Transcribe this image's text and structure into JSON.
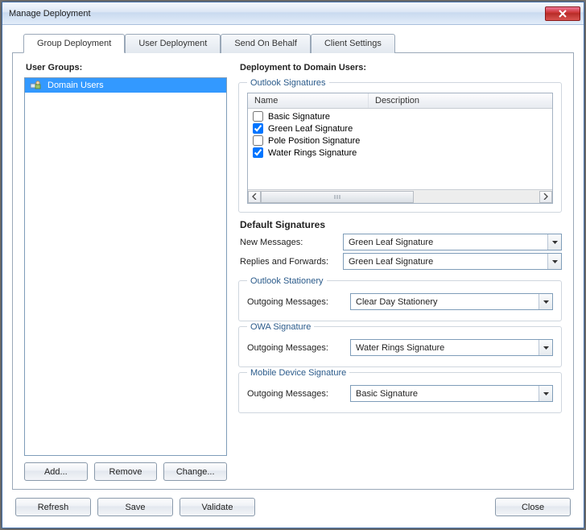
{
  "window": {
    "title": "Manage Deployment"
  },
  "tabs": {
    "items": [
      {
        "label": "Group Deployment"
      },
      {
        "label": "User Deployment"
      },
      {
        "label": "Send On Behalf"
      },
      {
        "label": "Client Settings"
      }
    ],
    "active_index": 0
  },
  "left": {
    "heading": "User Groups:",
    "items": [
      {
        "label": "Domain Users"
      }
    ],
    "buttons": {
      "add": "Add...",
      "remove": "Remove",
      "change": "Change..."
    }
  },
  "right": {
    "heading": "Deployment to Domain Users:",
    "outlook_signatures": {
      "title": "Outlook Signatures",
      "columns": {
        "name": "Name",
        "description": "Description"
      },
      "rows": [
        {
          "checked": false,
          "name": "Basic Signature",
          "description": ""
        },
        {
          "checked": true,
          "name": "Green Leaf Signature",
          "description": ""
        },
        {
          "checked": false,
          "name": "Pole Position Signature",
          "description": ""
        },
        {
          "checked": true,
          "name": "Water Rings Signature",
          "description": ""
        }
      ]
    },
    "default_signatures": {
      "heading": "Default Signatures",
      "new_messages_label": "New Messages:",
      "new_messages_value": "Green Leaf Signature",
      "replies_label": "Replies and Forwards:",
      "replies_value": "Green Leaf Signature"
    },
    "outlook_stationery": {
      "title": "Outlook Stationery",
      "label": "Outgoing Messages:",
      "value": "Clear Day Stationery"
    },
    "owa_signature": {
      "title": "OWA Signature",
      "label": "Outgoing Messages:",
      "value": "Water Rings Signature"
    },
    "mobile_signature": {
      "title": "Mobile Device Signature",
      "label": "Outgoing Messages:",
      "value": "Basic Signature"
    }
  },
  "footer": {
    "refresh": "Refresh",
    "save": "Save",
    "validate": "Validate",
    "close": "Close"
  }
}
